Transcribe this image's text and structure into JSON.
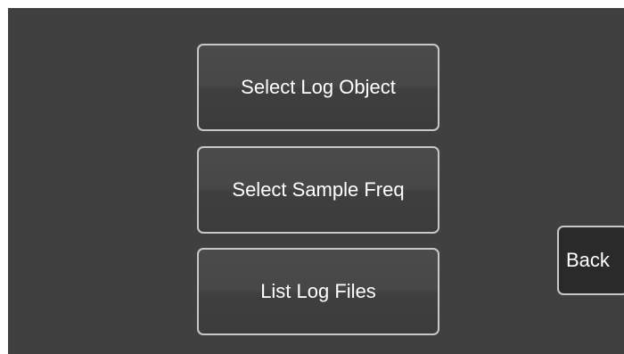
{
  "menu": {
    "select_log_object_label": "Select Log Object",
    "select_sample_freq_label": "Select Sample Freq",
    "list_log_files_label": "List Log Files"
  },
  "nav": {
    "back_label": "Back"
  },
  "colors": {
    "screen_background": "#404040",
    "button_border": "#c8c8c8",
    "button_text": "#ffffff",
    "back_button_fill": "#2a2a2a"
  }
}
